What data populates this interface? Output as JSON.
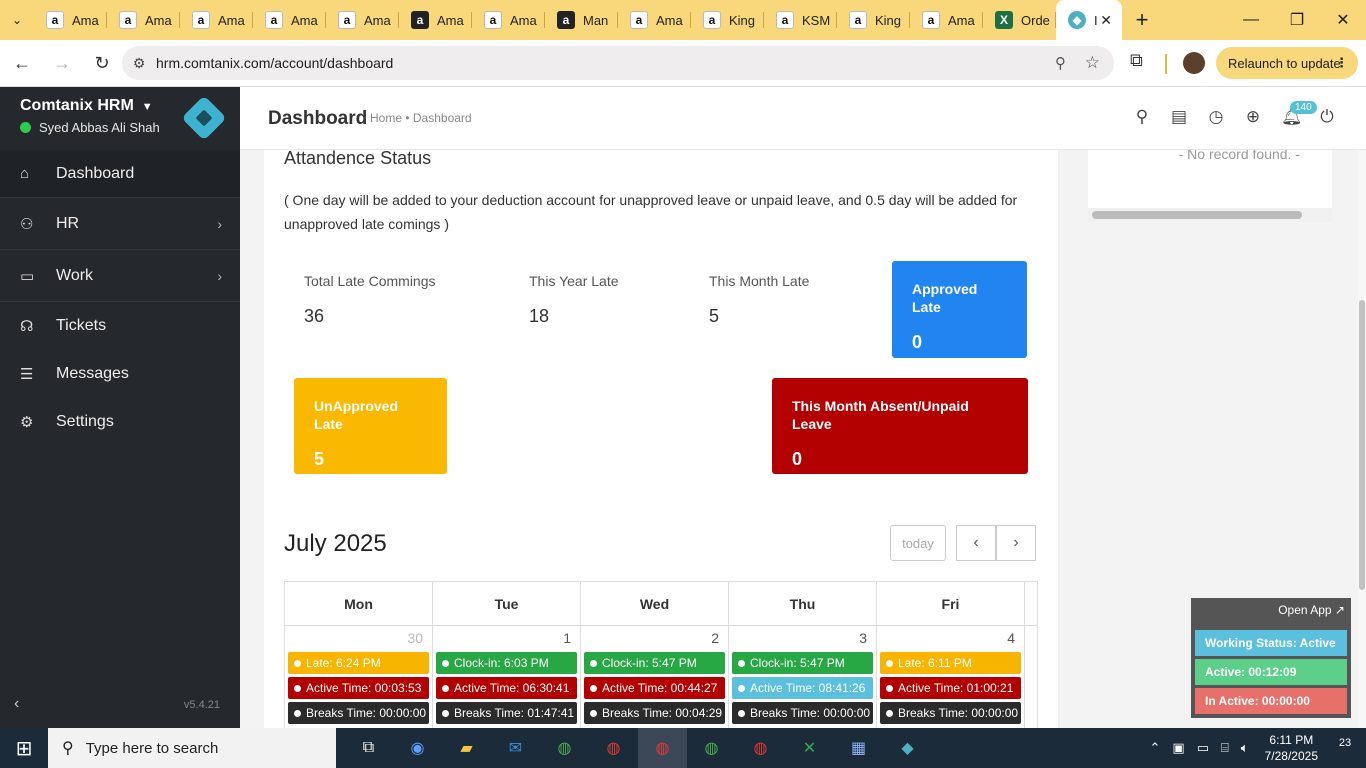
{
  "browser": {
    "tabs": [
      {
        "label": "Ama",
        "icon": "amazon"
      },
      {
        "label": "Ama",
        "icon": "amazon"
      },
      {
        "label": "Ama",
        "icon": "amazon"
      },
      {
        "label": "Ama",
        "icon": "amazon"
      },
      {
        "label": "Ama",
        "icon": "amazon"
      },
      {
        "label": "Ama",
        "icon": "amazon-dark"
      },
      {
        "label": "Ama",
        "icon": "amazon"
      },
      {
        "label": "Man",
        "icon": "amazon-dark"
      },
      {
        "label": "Ama",
        "icon": "amazon"
      },
      {
        "label": "King",
        "icon": "amazon"
      },
      {
        "label": "KSM",
        "icon": "amazon"
      },
      {
        "label": "King",
        "icon": "amazon"
      },
      {
        "label": "Ama",
        "icon": "amazon"
      },
      {
        "label": "Orde",
        "icon": "excel"
      }
    ],
    "active_tab": {
      "label": "I",
      "icon": "app"
    },
    "url": "hrm.comtanix.com/account/dashboard",
    "relaunch_label": "Relaunch to update"
  },
  "sidebar": {
    "brand": "Comtanix HRM",
    "user": "Syed Abbas Ali Shah",
    "items": [
      {
        "label": "Dashboard",
        "icon": "home-icon"
      },
      {
        "label": "HR",
        "icon": "users-icon"
      },
      {
        "label": "Work",
        "icon": "briefcase-icon"
      },
      {
        "label": "Tickets",
        "icon": "headset-icon"
      },
      {
        "label": "Messages",
        "icon": "message-icon"
      },
      {
        "label": "Settings",
        "icon": "gear-icon"
      }
    ],
    "version": "v5.4.21"
  },
  "header": {
    "title": "Dashboard",
    "breadcrumb": "Home • Dashboard",
    "notif_count": "140"
  },
  "attendance": {
    "title": "Attandence Status",
    "note": "( One day will be added to your deduction account for unapproved leave or unpaid leave, and 0.5 day will be added for unapproved late comings )",
    "stats": [
      {
        "label": "Total Late Commings",
        "value": "36"
      },
      {
        "label": "This Year Late",
        "value": "18"
      },
      {
        "label": "This Month Late",
        "value": "5"
      }
    ],
    "approved": {
      "label": "Approved Late",
      "value": "0",
      "color": "#2185f1"
    },
    "unapproved": {
      "label": "UnApproved Late",
      "value": "5",
      "color": "#fbb800"
    },
    "absent": {
      "label": "This Month Absent/Unpaid Leave",
      "value": "0",
      "color": "#b30000"
    }
  },
  "right_panel": {
    "no_record": "- No record found. -"
  },
  "calendar": {
    "title": "July 2025",
    "today_label": "today",
    "days": [
      "Mon",
      "Tue",
      "Wed",
      "Thu",
      "Fri"
    ],
    "cells": [
      {
        "date": "30",
        "muted": true,
        "events": [
          {
            "t": "Late: 6:24 PM",
            "c": "yellow"
          },
          {
            "t": "Active Time: 00:03:53",
            "c": "red"
          },
          {
            "t": "Breaks Time: 00:00:00",
            "c": "dark"
          }
        ]
      },
      {
        "date": "1",
        "muted": false,
        "events": [
          {
            "t": "Clock-in: 6:03 PM",
            "c": "green"
          },
          {
            "t": "Active Time: 06:30:41",
            "c": "red"
          },
          {
            "t": "Breaks Time: 01:47:41",
            "c": "dark"
          }
        ]
      },
      {
        "date": "2",
        "muted": false,
        "events": [
          {
            "t": "Clock-in: 5:47 PM",
            "c": "green"
          },
          {
            "t": "Active Time: 00:44:27",
            "c": "red"
          },
          {
            "t": "Breaks Time: 00:04:29",
            "c": "dark"
          }
        ]
      },
      {
        "date": "3",
        "muted": false,
        "events": [
          {
            "t": "Clock-in: 5:47 PM",
            "c": "green"
          },
          {
            "t": "Active Time: 08:41:26",
            "c": "teal"
          },
          {
            "t": "Breaks Time: 00:00:00",
            "c": "dark"
          }
        ]
      },
      {
        "date": "4",
        "muted": false,
        "events": [
          {
            "t": "Late: 6:11 PM",
            "c": "yellow"
          },
          {
            "t": "Active Time: 01:00:21",
            "c": "red"
          },
          {
            "t": "Breaks Time: 00:00:00",
            "c": "dark"
          }
        ]
      }
    ]
  },
  "widget": {
    "open_app": "Open App ↗",
    "working": "Working Status: Active",
    "active": "Active: 00:12:09",
    "inactive": "In Active: 00:00:00"
  },
  "taskbar": {
    "search_placeholder": "Type here to search",
    "time": "6:11 PM",
    "date": "7/28/2025",
    "notif_count": "23"
  }
}
